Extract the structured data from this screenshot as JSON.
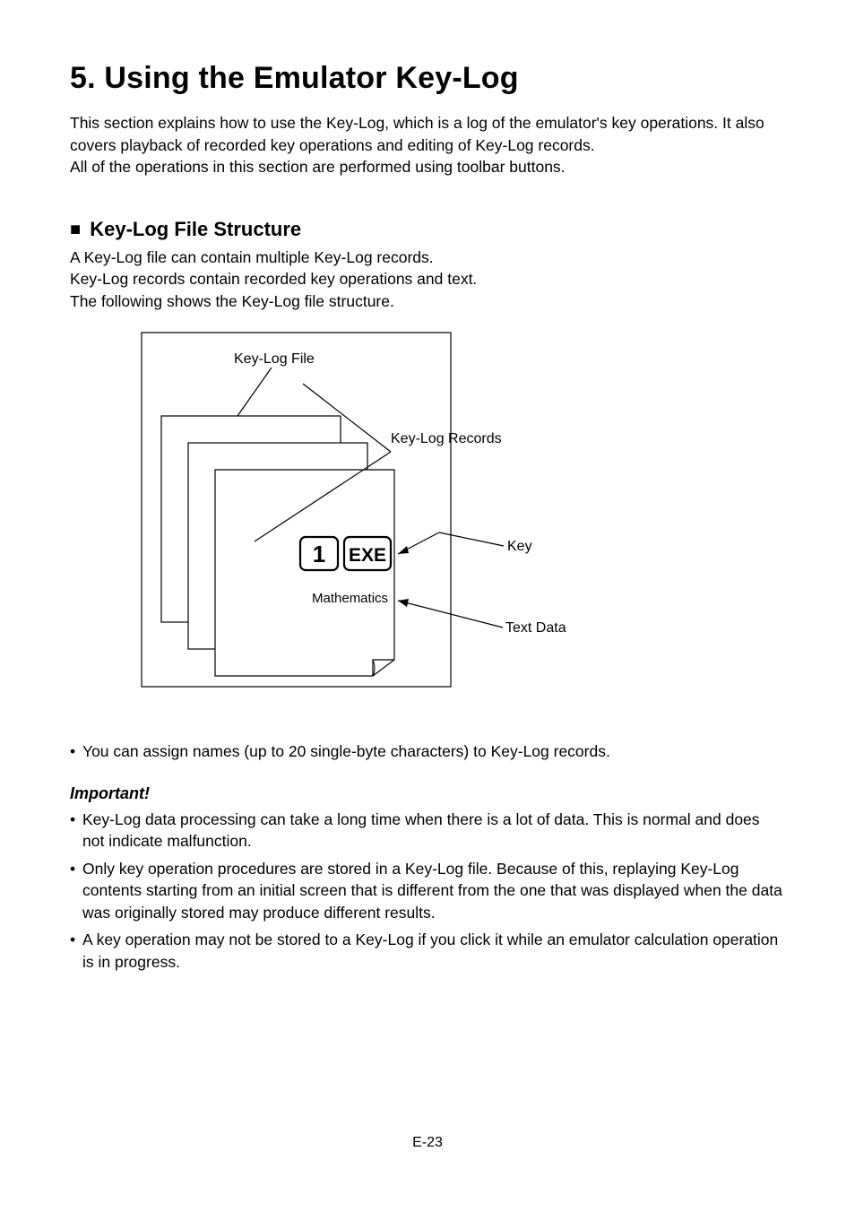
{
  "chapter": {
    "title": "5. Using the Emulator Key-Log",
    "intro_p1": "This section explains how to use the Key-Log, which is a log of the emulator's key operations. It also covers playback of recorded key operations and editing of Key-Log records.",
    "intro_p2": "All of the operations in this section are performed using toolbar buttons."
  },
  "section": {
    "heading": "Key-Log File Structure",
    "p1": "A Key-Log file can contain multiple Key-Log records.",
    "p2": "Key-Log records contain recorded key operations and text.",
    "p3": "The following shows the Key-Log file structure."
  },
  "diagram": {
    "file_label": "Key-Log File",
    "records_label": "Key-Log Records",
    "key_label": "Key",
    "text_data_label": "Text Data",
    "inner_text_label": "Mathematics",
    "key1_glyph": "1",
    "key2_glyph": "EXE"
  },
  "bullets": {
    "b1": "You can assign names (up to 20 single-byte characters) to Key-Log records."
  },
  "important": {
    "heading": "Important!",
    "i1": "Key-Log data processing can take a long time when there is a lot of data. This is normal and does not indicate malfunction.",
    "i2": "Only key operation procedures are stored in a Key-Log file. Because of this, replaying Key-Log contents starting from an initial screen that is different from the one that was displayed when the data was originally stored may produce different results.",
    "i3": "A key operation may not be stored to a Key-Log if you click it while an emulator calculation operation is in progress."
  },
  "page_number": "E-23"
}
